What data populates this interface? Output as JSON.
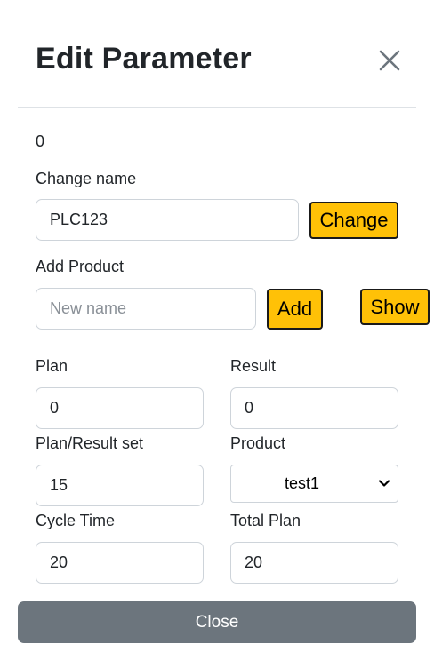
{
  "modal": {
    "title": "Edit Parameter",
    "id_value": "0",
    "close_button": "Close"
  },
  "change_name": {
    "label": "Change name",
    "value": "PLC123",
    "button": "Change"
  },
  "add_product": {
    "label": "Add Product",
    "placeholder": "New name",
    "add_button": "Add",
    "show_button": "Show"
  },
  "fields": {
    "plan": {
      "label": "Plan",
      "value": "0"
    },
    "result": {
      "label": "Result",
      "value": "0"
    },
    "plan_result_set": {
      "label": "Plan/Result set",
      "value": "15"
    },
    "product": {
      "label": "Product",
      "selected": "test1"
    },
    "cycle_time": {
      "label": "Cycle Time",
      "value": "20"
    },
    "total_plan": {
      "label": "Total Plan",
      "value": "20"
    }
  },
  "icons": {
    "close": "close-icon",
    "dropdown": "chevron-down-icon"
  },
  "colors": {
    "accent_button": "#ffc107",
    "close_button": "#6c757d"
  }
}
